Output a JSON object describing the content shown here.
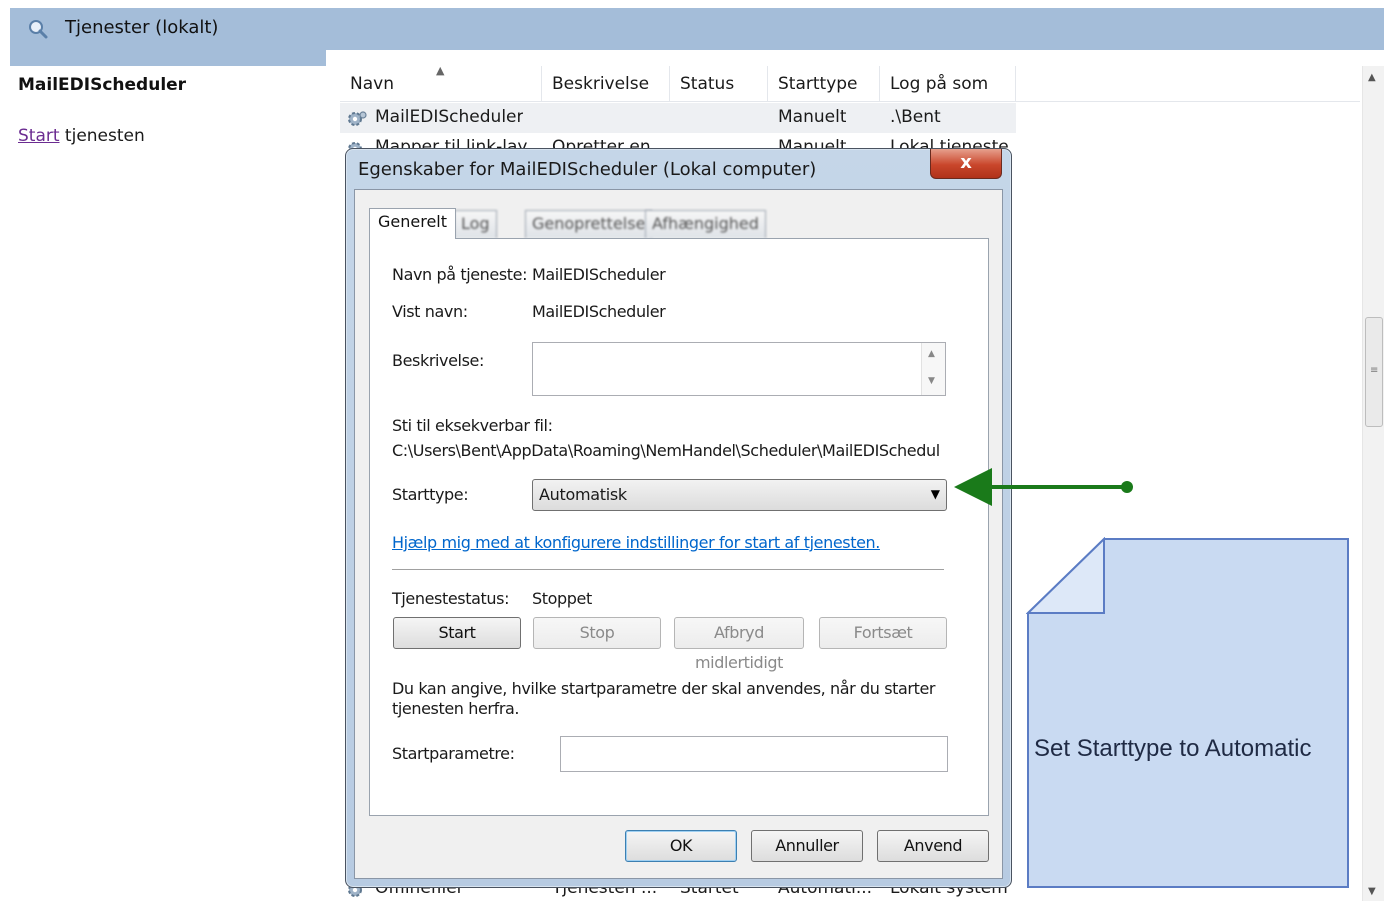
{
  "window": {
    "title": "Tjenester (lokalt)"
  },
  "left_pane": {
    "service_name": "MailEDIScheduler",
    "start_link": "Start",
    "start_suffix": " tjenesten"
  },
  "list": {
    "columns": [
      "Navn",
      "Beskrivelse",
      "Status",
      "Starttype",
      "Log på som"
    ],
    "rows": [
      {
        "name": "MailEDIScheduler",
        "description": "",
        "status": "",
        "starttype": "Manuelt",
        "logon": ".\\Bent"
      },
      {
        "name": "Mapper til link-lay...",
        "description": "Opretter en...",
        "status": "",
        "starttype": "Manuelt",
        "logon": "Lokal tjeneste"
      },
      {
        "name": "Offlinefiler",
        "description": "Tjenesten ...",
        "status": "Startet",
        "starttype": "Automati...",
        "logon": "Lokalt system"
      }
    ]
  },
  "dialog": {
    "title": "Egenskaber for MailEDIScheduler (Lokal computer)",
    "close_label": "x",
    "tabs": [
      "Generelt",
      "Log på",
      "Genoprettelse",
      "Afhængighed"
    ],
    "service_name_label": "Navn på tjeneste:",
    "service_name_value": "MailEDIScheduler",
    "display_name_label": "Vist navn:",
    "display_name_value": "MailEDIScheduler",
    "description_label": "Beskrivelse:",
    "path_label": "Sti til eksekverbar fil:",
    "path_value": "C:\\Users\\Bent\\AppData\\Roaming\\NemHandel\\Scheduler\\MailEDISchedul",
    "starttype_label": "Starttype:",
    "starttype_value": "Automatisk",
    "help_link": "Hjælp mig med at konfigurere indstillinger for start af tjenesten.",
    "status_label": "Tjenestestatus:",
    "status_value": "Stoppet",
    "buttons": {
      "start": "Start",
      "stop": "Stop",
      "pause": "Afbryd midlertidigt",
      "resume": "Fortsæt"
    },
    "params_hint_line1": "Du kan angive, hvilke startparametre der skal anvendes, når du starter",
    "params_hint_line2": "tjenesten herfra.",
    "params_label": "Startparametre:",
    "params_value": "",
    "footer": {
      "ok": "OK",
      "cancel": "Annuller",
      "apply": "Anvend"
    }
  },
  "annotation": {
    "note_text": "Set Starttype to Automatic",
    "arrow_color": "#1a7a1a",
    "note_fill": "#c9daf2",
    "note_border": "#5b7cc4"
  }
}
